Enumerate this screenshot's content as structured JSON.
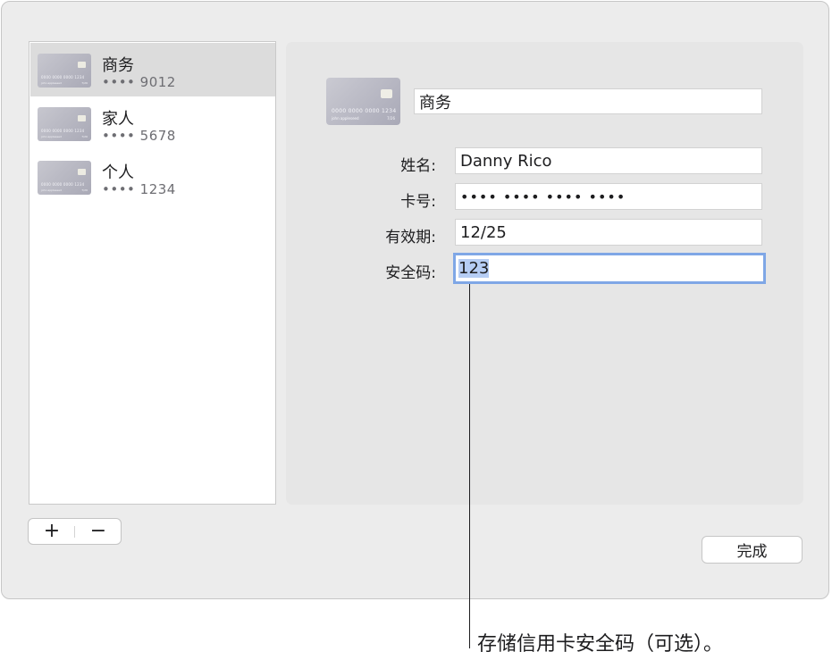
{
  "cards": [
    {
      "name": "商务",
      "masked": "•••• 9012",
      "selected": true
    },
    {
      "name": "家人",
      "masked": "•••• 5678",
      "selected": false
    },
    {
      "name": "个人",
      "masked": "•••• 1234",
      "selected": false
    }
  ],
  "card_art": {
    "number": "0000 0000 0000 1234",
    "holder": "john appleseed",
    "expiry": "7/26"
  },
  "controls": {
    "add_label": "+",
    "remove_label": "−",
    "done_label": "完成"
  },
  "detail": {
    "card_title": "商务",
    "name_label": "姓名:",
    "name_value": "Danny Rico",
    "number_label": "卡号:",
    "number_value": "•••• •••• •••• ••••",
    "expiry_label": "有效期:",
    "expiry_value": "12/25",
    "cvv_label": "安全码:",
    "cvv_value": "123"
  },
  "callout": "存储信用卡安全码（可选）。",
  "colors": {
    "selection": "#dcdcdc",
    "focus_ring": "#7fa7e6",
    "text_selection": "#b6cdf4"
  }
}
